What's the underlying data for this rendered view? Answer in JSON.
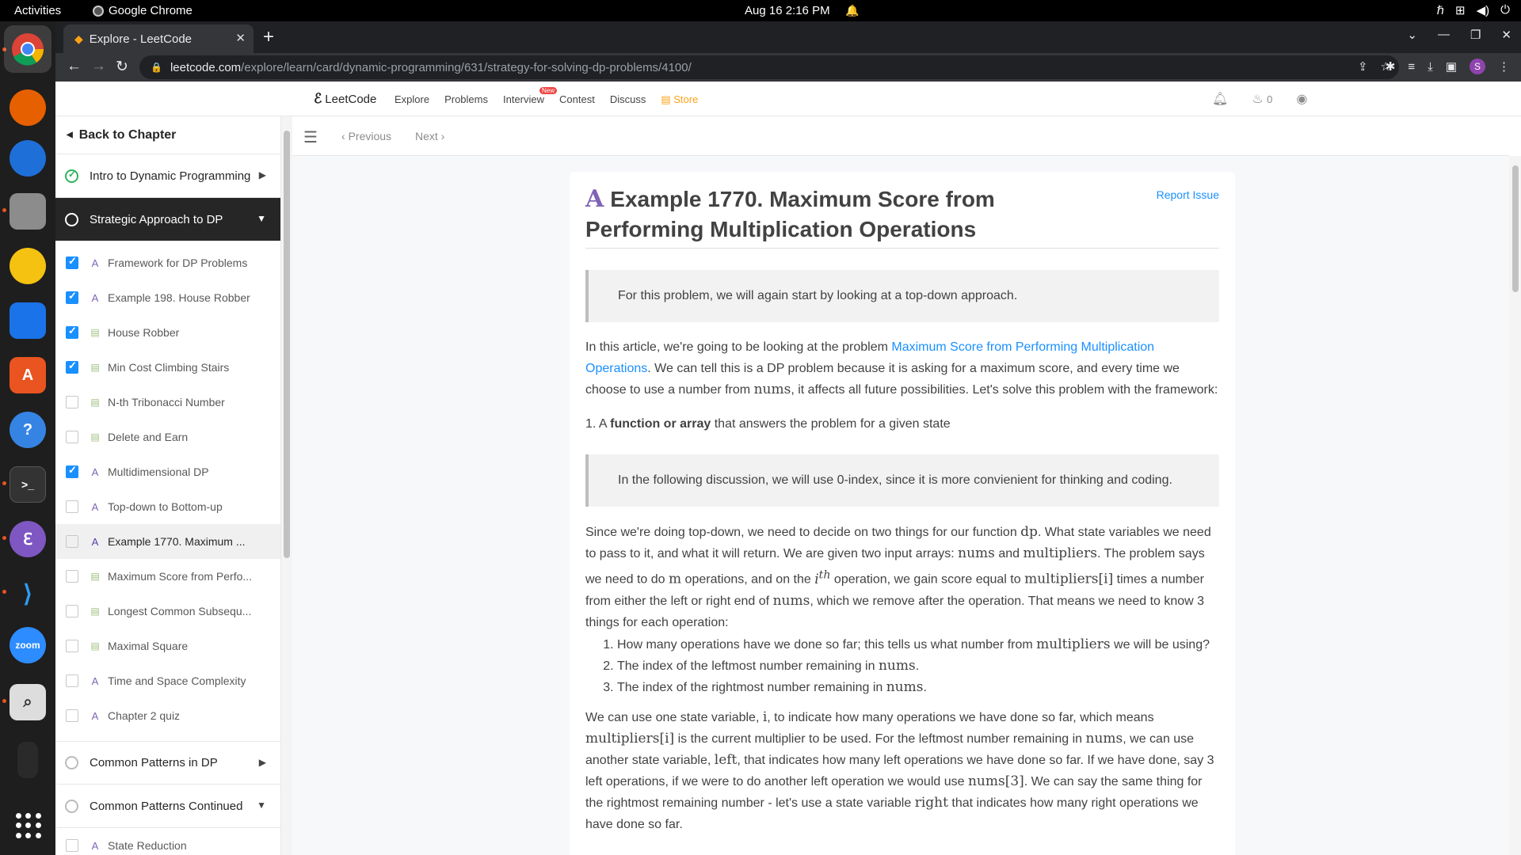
{
  "system": {
    "activities": "Activities",
    "app_name": "Google Chrome",
    "clock": "Aug 16  2:16 PM"
  },
  "dock": {
    "apps": [
      "chrome",
      "firefox",
      "thunderbird",
      "files",
      "rhythmbox",
      "writer",
      "app-center",
      "help",
      "terminal",
      "emacs",
      "vscode",
      "zoom",
      "magnifier",
      "trash"
    ],
    "zoom_label": "zoom"
  },
  "browser": {
    "tab_title": "Explore - LeetCode",
    "url_host": "leetcode.com",
    "url_path": "/explore/learn/card/dynamic-programming/631/strategy-for-solving-dp-problems/4100/",
    "profile_initial": "S"
  },
  "leetcode_nav": {
    "logo": "LeetCode",
    "items": [
      "Explore",
      "Problems",
      "Interview",
      "Contest",
      "Discuss",
      "Store"
    ],
    "new_badge": "New",
    "coins": "0"
  },
  "sidebar": {
    "back_label": "Back to Chapter",
    "chapters": [
      {
        "title": "Intro to Dynamic Programming"
      },
      {
        "title": "Strategic Approach to DP"
      },
      {
        "title": "Common Patterns in DP"
      },
      {
        "title": "Common Patterns Continued"
      }
    ],
    "lessons": [
      {
        "title": "Framework for DP Problems",
        "type": "article",
        "done": true
      },
      {
        "title": "Example 198. House Robber",
        "type": "article",
        "done": true
      },
      {
        "title": "House Robber",
        "type": "problem",
        "done": true
      },
      {
        "title": "Min Cost Climbing Stairs",
        "type": "problem",
        "done": true
      },
      {
        "title": "N-th Tribonacci Number",
        "type": "problem",
        "done": false
      },
      {
        "title": "Delete and Earn",
        "type": "problem",
        "done": false
      },
      {
        "title": "Multidimensional DP",
        "type": "article",
        "done": true
      },
      {
        "title": "Top-down to Bottom-up",
        "type": "article",
        "done": false
      },
      {
        "title": "Example 1770. Maximum ...",
        "type": "article",
        "done": false
      },
      {
        "title": "Maximum Score from Perfo...",
        "type": "problem",
        "done": false
      },
      {
        "title": "Longest Common Subsequ...",
        "type": "problem",
        "done": false
      },
      {
        "title": "Maximal Square",
        "type": "problem",
        "done": false
      },
      {
        "title": "Time and Space Complexity",
        "type": "article",
        "done": false
      },
      {
        "title": "Chapter 2 quiz",
        "type": "article",
        "done": false
      }
    ],
    "after_lesson": "State Reduction"
  },
  "content_bar": {
    "prev": "Previous",
    "next": "Next"
  },
  "article": {
    "title": "Example 1770. Maximum Score from Performing Multiplication Operations",
    "report": "Report Issue",
    "quote1": "For this problem, we will again start by looking at a top-down approach.",
    "p1_before": "In this article, we're going to be looking at the problem ",
    "p1_link": "Maximum Score from Performing Multiplication Operations",
    "p1_after": ". We can tell this is a DP problem because it is asking for a maximum score, and every time we choose to use a number from ",
    "p1_math": "nums",
    "p1_end": ", it affects all future possibilities. Let's solve this problem with the framework:",
    "step1_num": "1. A ",
    "step1_bold": "function or array",
    "step1_rest": " that answers the problem for a given state",
    "quote2": "In the following discussion, we will use 0-index, since it is more convienient for thinking and coding.",
    "list": [
      "How many operations have we done so far; this tells us what number from multipliers we will be using?",
      "The index of the leftmost number remaining in nums.",
      "The index of the rightmost number remaining in nums."
    ]
  }
}
